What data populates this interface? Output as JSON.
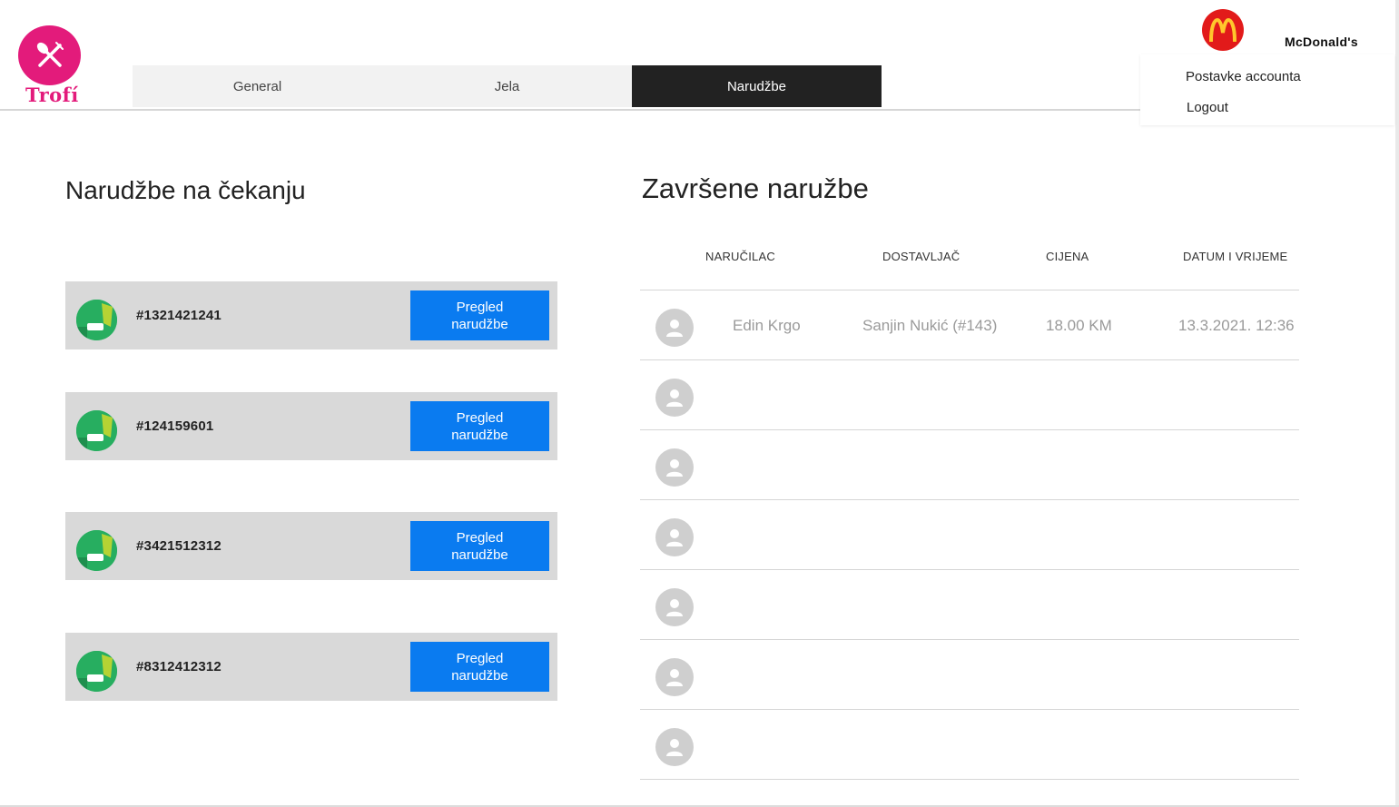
{
  "brand": {
    "name": "Trofí",
    "color": "#e31b7b"
  },
  "tabs": [
    {
      "label": "General",
      "active": false
    },
    {
      "label": "Jela",
      "active": false
    },
    {
      "label": "Narudžbe",
      "active": true
    }
  ],
  "account": {
    "name": "McDonald's",
    "logo_icon": "mcdonalds-logo",
    "menu": [
      "Postavke accounta",
      "Logout"
    ]
  },
  "pending": {
    "title": "Narudžbe na čekanju",
    "button_label_line1": "Pregled",
    "button_label_line2": "narudžbe",
    "orders": [
      {
        "id": "#1321421241"
      },
      {
        "id": "#124159601"
      },
      {
        "id": "#3421512312"
      },
      {
        "id": "#8312412312"
      }
    ]
  },
  "completed": {
    "title": "Završene naružbe",
    "columns": [
      "NARUČILAC",
      "DOSTAVLJAČ",
      "CIJENA",
      "DATUM I VRIJEME"
    ],
    "rows": [
      {
        "customer": "Edin Krgo",
        "courier": "Sanjin Nukić (#143)",
        "price": "18.00 KM",
        "datetime": "13.3.2021. 12:36"
      },
      {
        "customer": "",
        "courier": "",
        "price": "",
        "datetime": ""
      },
      {
        "customer": "",
        "courier": "",
        "price": "",
        "datetime": ""
      },
      {
        "customer": "",
        "courier": "",
        "price": "",
        "datetime": ""
      },
      {
        "customer": "",
        "courier": "",
        "price": "",
        "datetime": ""
      },
      {
        "customer": "",
        "courier": "",
        "price": "",
        "datetime": ""
      },
      {
        "customer": "",
        "courier": "",
        "price": "",
        "datetime": ""
      }
    ]
  },
  "colors": {
    "accent_button": "#0a7bf0",
    "active_tab": "#222222",
    "avatar_green": "#27ae60"
  }
}
